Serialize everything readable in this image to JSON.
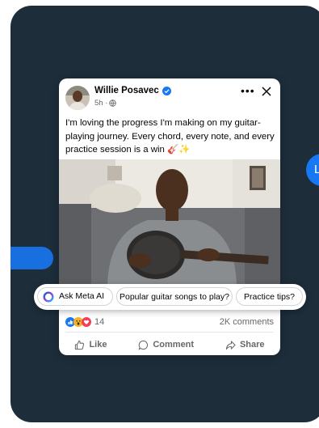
{
  "background": {
    "phone_color": "#1d2d3a",
    "bubble_color": "#1877f2",
    "right_bubble_text": "Le"
  },
  "post": {
    "author": "Willie Posavec",
    "time": "5h ·",
    "text": "I'm loving the progress I'm making on my guitar-playing journey. Every chord, every note, and every practice session is a win 🎸✨",
    "more_label": "•••",
    "reaction_count": "14",
    "comments_count": "2K comments"
  },
  "actions": {
    "like": "Like",
    "comment": "Comment",
    "share": "Share"
  },
  "suggestions": {
    "ask_meta_ai": "Ask Meta AI",
    "chip1": "Popular guitar songs to play?",
    "chip2": "Practice tips?"
  },
  "icons": {
    "verified": "verified-badge-icon",
    "globe": "globe-icon",
    "close": "close-icon",
    "like": "thumbs-up-icon",
    "comment": "comment-bubble-icon",
    "share": "share-arrow-icon",
    "meta_ai": "meta-ai-ring-icon"
  },
  "colors": {
    "accent": "#1877f2",
    "secondary_text": "#65676b"
  }
}
